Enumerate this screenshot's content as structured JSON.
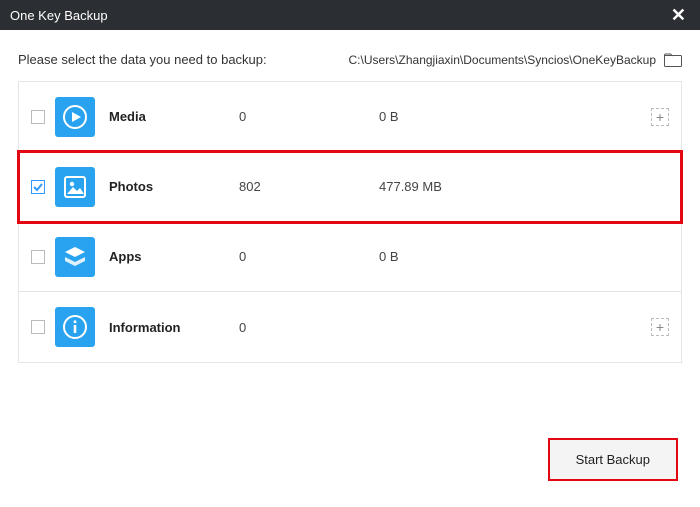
{
  "window": {
    "title": "One Key Backup"
  },
  "header": {
    "prompt": "Please select the data you need to backup:",
    "path": "C:\\Users\\Zhangjiaxin\\Documents\\Syncios\\OneKeyBackup"
  },
  "rows": [
    {
      "icon": "play",
      "name": "Media",
      "count": "0",
      "size": "0 B",
      "checked": false,
      "showAdd": true,
      "highlight": false
    },
    {
      "icon": "photo",
      "name": "Photos",
      "count": "802",
      "size": "477.89 MB",
      "checked": true,
      "showAdd": false,
      "highlight": true
    },
    {
      "icon": "apps",
      "name": "Apps",
      "count": "0",
      "size": "0 B",
      "checked": false,
      "showAdd": false,
      "highlight": false
    },
    {
      "icon": "info",
      "name": "Information",
      "count": "0",
      "size": "",
      "checked": false,
      "showAdd": true,
      "highlight": false
    }
  ],
  "footer": {
    "start_label": "Start Backup"
  }
}
